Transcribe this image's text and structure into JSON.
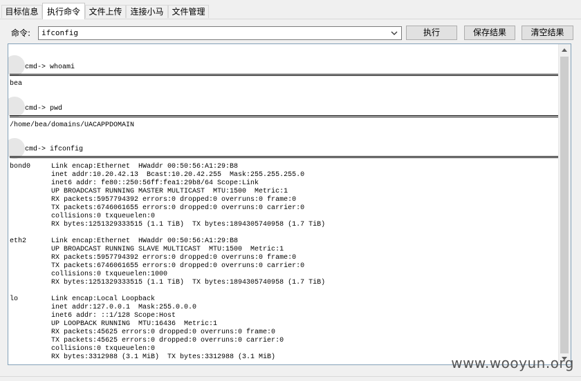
{
  "tabs": [
    "目标信息",
    "执行命令",
    "文件上传",
    "连接小马",
    "文件管理"
  ],
  "active_tab": "执行命令",
  "command": {
    "label": "命令:",
    "value": "ifconfig"
  },
  "buttons": {
    "execute": "执行",
    "save": "保存结果",
    "clear": "清空结果"
  },
  "output": {
    "blocks": [
      {
        "prompt": "cmd-> whoami",
        "lines": [
          "bea"
        ]
      },
      {
        "prompt": "cmd-> pwd",
        "lines": [
          "/home/bea/domains/UACAPPDOMAIN"
        ]
      },
      {
        "prompt": "cmd-> ifconfig",
        "lines": [
          "bond0     Link encap:Ethernet  HWaddr 00:50:56:A1:29:B8",
          "          inet addr:10.20.42.13  Bcast:10.20.42.255  Mask:255.255.255.0",
          "          inet6 addr: fe80::250:56ff:fea1:29b8/64 Scope:Link",
          "          UP BROADCAST RUNNING MASTER MULTICAST  MTU:1500  Metric:1",
          "          RX packets:5957794392 errors:0 dropped:0 overruns:0 frame:0",
          "          TX packets:6746061655 errors:0 dropped:0 overruns:0 carrier:0",
          "          collisions:0 txqueuelen:0",
          "          RX bytes:1251329333515 (1.1 TiB)  TX bytes:1894305740958 (1.7 TiB)",
          "",
          "eth2      Link encap:Ethernet  HWaddr 00:50:56:A1:29:B8",
          "          UP BROADCAST RUNNING SLAVE MULTICAST  MTU:1500  Metric:1",
          "          RX packets:5957794392 errors:0 dropped:0 overruns:0 frame:0",
          "          TX packets:6746061655 errors:0 dropped:0 overruns:0 carrier:0",
          "          collisions:0 txqueuelen:1000",
          "          RX bytes:1251329333515 (1.1 TiB)  TX bytes:1894305740958 (1.7 TiB)",
          "",
          "lo        Link encap:Local Loopback",
          "          inet addr:127.0.0.1  Mask:255.0.0.0",
          "          inet6 addr: ::1/128 Scope:Host",
          "          UP LOOPBACK RUNNING  MTU:16436  Metric:1",
          "          RX packets:45625 errors:0 dropped:0 overruns:0 frame:0",
          "          TX packets:45625 errors:0 dropped:0 overruns:0 carrier:0",
          "          collisions:0 txqueuelen:0",
          "          RX bytes:3312988 (3.1 MiB)  TX bytes:3312988 (3.1 MiB)"
        ]
      }
    ]
  },
  "watermark": "www.wooyun.org"
}
